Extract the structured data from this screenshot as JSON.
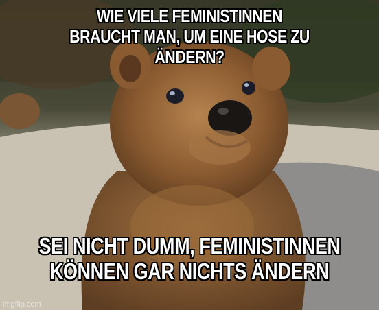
{
  "meme": {
    "top_text": [
      "WIE VIELE FEMINISTINNEN",
      "BRAUCHT MAN, UM EINE HOSE ZU ÄNDERN?"
    ],
    "bottom_text": [
      "SEI NICHT DUMM, FEMINISTINNEN",
      "KÖNNEN GAR NICHTS ÄNDERN"
    ],
    "watermark": "imgflip.com"
  },
  "colors": {
    "fur": "#8a5a30",
    "fur_light": "#b07a45",
    "background_dark": "#3b3a2a",
    "ground": "#c8c0b0",
    "text": "#ffffff"
  }
}
